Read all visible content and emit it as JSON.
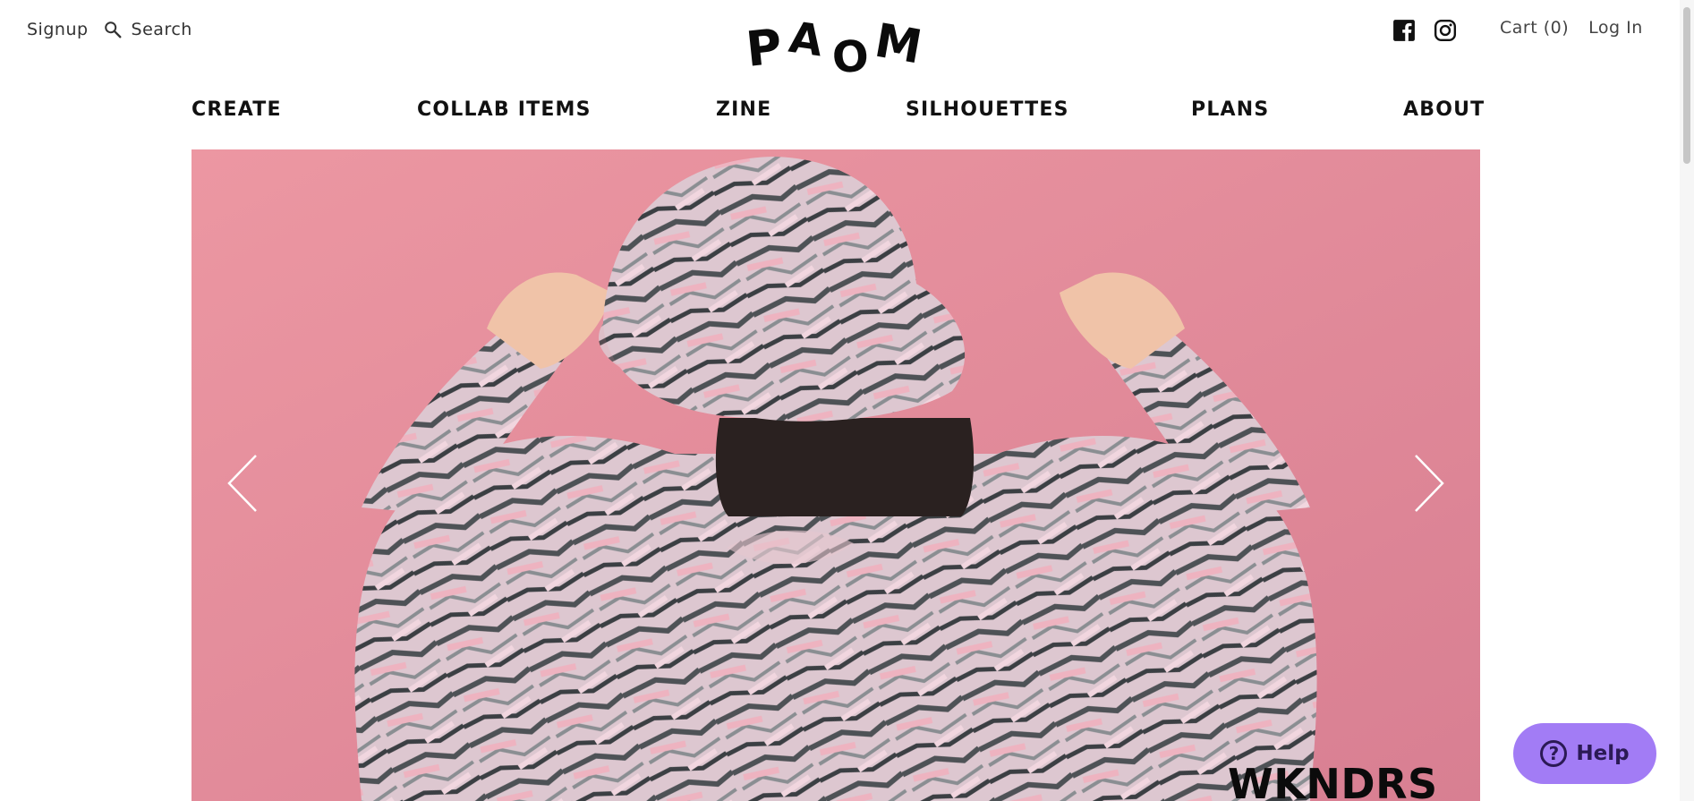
{
  "header": {
    "signup_label": "Signup",
    "search_label": "Search",
    "logo_text": "PAOM",
    "cart_label": "Cart (0)",
    "login_label": "Log In",
    "social_icons": [
      "facebook-icon",
      "instagram-icon"
    ]
  },
  "nav": {
    "items": [
      {
        "label": "CREATE"
      },
      {
        "label": "COLLAB ITEMS"
      },
      {
        "label": "ZINE"
      },
      {
        "label": "SILHOUETTES"
      },
      {
        "label": "PLANS"
      },
      {
        "label": "ABOUT"
      }
    ]
  },
  "hero": {
    "title": "WKNDRS",
    "background_color": "#e8909c",
    "prev_icon": "chevron-left-icon",
    "next_icon": "chevron-right-icon"
  },
  "help": {
    "label": "Help",
    "color": "#a27cf5"
  }
}
